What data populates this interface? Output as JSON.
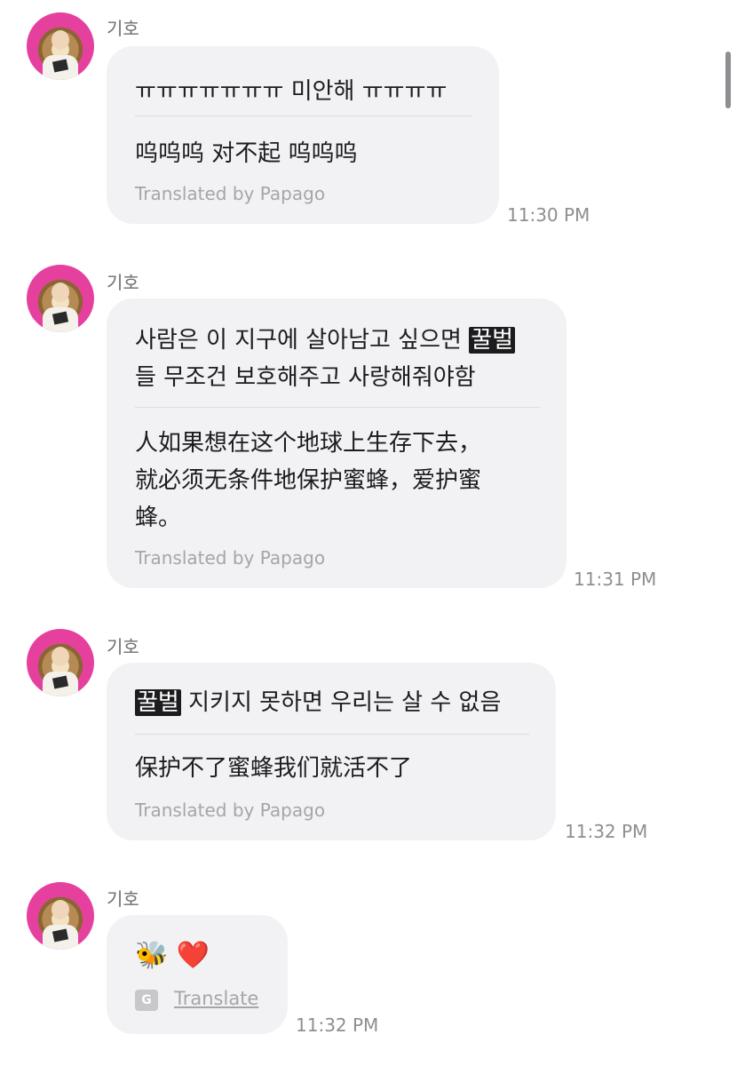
{
  "messages": [
    {
      "sender": "기호",
      "original": "ㅠㅠㅠㅠㅠㅠㅠ 미안해 ㅠㅠㅠㅠ",
      "translation": "呜呜呜 对不起 呜呜呜",
      "credit": "Translated by Papago",
      "time": "11:30 PM"
    },
    {
      "sender": "기호",
      "original_line1_before": "사람은 이 지구에 살아남고 싶으면 ",
      "original_highlight": "꿀벌",
      "original_line2": "들 무조건 보호해주고 사랑해줘야함",
      "translation_line1": "人如果想在这个地球上生存下去，",
      "translation_line2": "就必须无条件地保护蜜蜂，爱护蜜",
      "translation_line3": "蜂。",
      "credit": "Translated by Papago",
      "time": "11:31 PM"
    },
    {
      "sender": "기호",
      "original_highlight": "꿀벌",
      "original_after": " 지키지 못하면 우리는 살 수 없음",
      "translation": "保护不了蜜蜂我们就活不了",
      "credit": "Translated by Papago",
      "time": "11:32 PM"
    },
    {
      "sender": "기호",
      "emoji": "🐝 ❤️",
      "translate_icon": "translate-icon",
      "translate_label": "Translate",
      "time": "11:32 PM"
    }
  ]
}
